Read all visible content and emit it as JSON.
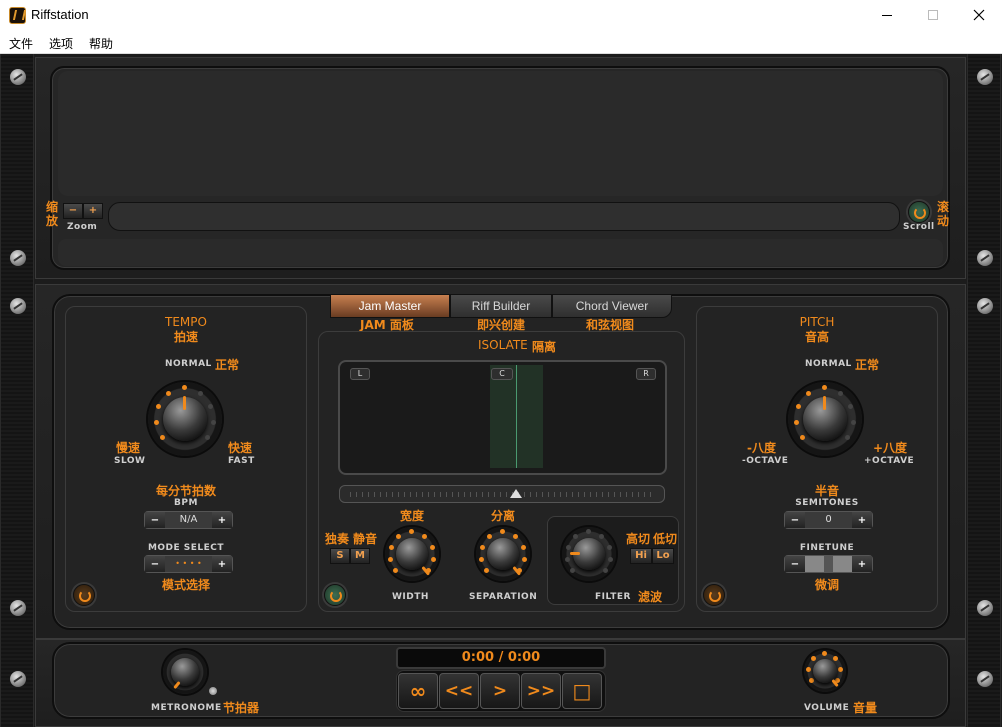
{
  "window": {
    "title": "Riffstation"
  },
  "menu": {
    "file": "文件",
    "options": "选项",
    "help": "帮助"
  },
  "waveform": {
    "zoom_cn_1": "缩",
    "zoom_cn_2": "放",
    "zoom_label": "Zoom",
    "scroll_cn_1": "滚",
    "scroll_cn_2": "动",
    "scroll_label": "Scroll",
    "minus": "−",
    "plus": "+"
  },
  "tabs": [
    {
      "label": "Jam Master",
      "cn": "JAM 面板"
    },
    {
      "label": "Riff Builder",
      "cn": "即兴创建"
    },
    {
      "label": "Chord Viewer",
      "cn": "和弦视图"
    }
  ],
  "tempo": {
    "title": "TEMPO",
    "title_cn": "拍速",
    "normal": "NORMAL",
    "normal_cn": "正常",
    "slow": "SLOW",
    "slow_cn": "慢速",
    "fast": "FAST",
    "fast_cn": "快速",
    "bpm_cn": "每分节拍数",
    "bpm": "BPM",
    "bpm_value": "N/A",
    "mode": "MODE SELECT",
    "mode_cn": "模式选择",
    "mode_value": "• • • •"
  },
  "isolate": {
    "title": "ISOLATE",
    "title_cn": "隔离",
    "left": "L",
    "center": "C",
    "right": "R",
    "solo": "S",
    "mute": "M",
    "solo_cn": "独奏",
    "mute_cn": "静音",
    "width": "WIDTH",
    "width_cn": "宽度",
    "separation": "SEPARATION",
    "separation_cn": "分离",
    "filter": "FILTER",
    "filter_cn": "滤波",
    "hi": "Hi",
    "lo": "Lo",
    "hi_cn": "高切",
    "lo_cn": "低切"
  },
  "pitch": {
    "title": "PITCH",
    "title_cn": "音高",
    "normal": "NORMAL",
    "normal_cn": "正常",
    "minus_octave": "-OCTAVE",
    "minus_octave_cn": "-八度",
    "plus_octave": "+OCTAVE",
    "plus_octave_cn": "+八度",
    "semitones": "SEMITONES",
    "semitones_cn": "半音",
    "semitones_value": "0",
    "finetune": "FINETUNE",
    "finetune_cn": "微调"
  },
  "transport": {
    "time": "0:00 / 0:00",
    "loop": "∞",
    "rewind": "<<",
    "play": ">",
    "forward": ">>",
    "stop": "□",
    "metronome": "METRONOME",
    "metronome_cn": "节拍器",
    "volume": "VOLUME",
    "volume_cn": "音量"
  },
  "colors": {
    "accent": "#f08a1c",
    "panel": "#262626"
  }
}
